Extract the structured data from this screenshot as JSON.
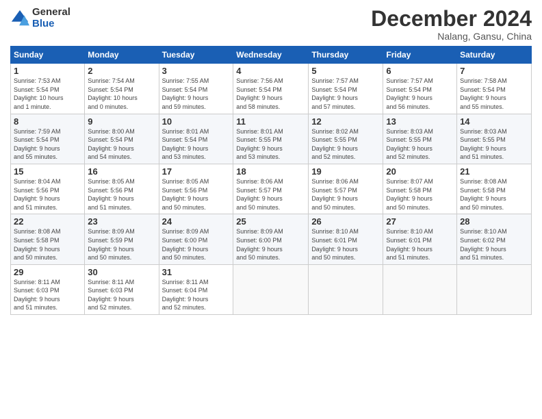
{
  "logo": {
    "general": "General",
    "blue": "Blue"
  },
  "header": {
    "month": "December 2024",
    "location": "Nalang, Gansu, China"
  },
  "days_of_week": [
    "Sunday",
    "Monday",
    "Tuesday",
    "Wednesday",
    "Thursday",
    "Friday",
    "Saturday"
  ],
  "weeks": [
    [
      {
        "day": "1",
        "info": "Sunrise: 7:53 AM\nSunset: 5:54 PM\nDaylight: 10 hours\nand 1 minute."
      },
      {
        "day": "2",
        "info": "Sunrise: 7:54 AM\nSunset: 5:54 PM\nDaylight: 10 hours\nand 0 minutes."
      },
      {
        "day": "3",
        "info": "Sunrise: 7:55 AM\nSunset: 5:54 PM\nDaylight: 9 hours\nand 59 minutes."
      },
      {
        "day": "4",
        "info": "Sunrise: 7:56 AM\nSunset: 5:54 PM\nDaylight: 9 hours\nand 58 minutes."
      },
      {
        "day": "5",
        "info": "Sunrise: 7:57 AM\nSunset: 5:54 PM\nDaylight: 9 hours\nand 57 minutes."
      },
      {
        "day": "6",
        "info": "Sunrise: 7:57 AM\nSunset: 5:54 PM\nDaylight: 9 hours\nand 56 minutes."
      },
      {
        "day": "7",
        "info": "Sunrise: 7:58 AM\nSunset: 5:54 PM\nDaylight: 9 hours\nand 55 minutes."
      }
    ],
    [
      {
        "day": "8",
        "info": "Sunrise: 7:59 AM\nSunset: 5:54 PM\nDaylight: 9 hours\nand 55 minutes."
      },
      {
        "day": "9",
        "info": "Sunrise: 8:00 AM\nSunset: 5:54 PM\nDaylight: 9 hours\nand 54 minutes."
      },
      {
        "day": "10",
        "info": "Sunrise: 8:01 AM\nSunset: 5:54 PM\nDaylight: 9 hours\nand 53 minutes."
      },
      {
        "day": "11",
        "info": "Sunrise: 8:01 AM\nSunset: 5:55 PM\nDaylight: 9 hours\nand 53 minutes."
      },
      {
        "day": "12",
        "info": "Sunrise: 8:02 AM\nSunset: 5:55 PM\nDaylight: 9 hours\nand 52 minutes."
      },
      {
        "day": "13",
        "info": "Sunrise: 8:03 AM\nSunset: 5:55 PM\nDaylight: 9 hours\nand 52 minutes."
      },
      {
        "day": "14",
        "info": "Sunrise: 8:03 AM\nSunset: 5:55 PM\nDaylight: 9 hours\nand 51 minutes."
      }
    ],
    [
      {
        "day": "15",
        "info": "Sunrise: 8:04 AM\nSunset: 5:56 PM\nDaylight: 9 hours\nand 51 minutes."
      },
      {
        "day": "16",
        "info": "Sunrise: 8:05 AM\nSunset: 5:56 PM\nDaylight: 9 hours\nand 51 minutes."
      },
      {
        "day": "17",
        "info": "Sunrise: 8:05 AM\nSunset: 5:56 PM\nDaylight: 9 hours\nand 50 minutes."
      },
      {
        "day": "18",
        "info": "Sunrise: 8:06 AM\nSunset: 5:57 PM\nDaylight: 9 hours\nand 50 minutes."
      },
      {
        "day": "19",
        "info": "Sunrise: 8:06 AM\nSunset: 5:57 PM\nDaylight: 9 hours\nand 50 minutes."
      },
      {
        "day": "20",
        "info": "Sunrise: 8:07 AM\nSunset: 5:58 PM\nDaylight: 9 hours\nand 50 minutes."
      },
      {
        "day": "21",
        "info": "Sunrise: 8:08 AM\nSunset: 5:58 PM\nDaylight: 9 hours\nand 50 minutes."
      }
    ],
    [
      {
        "day": "22",
        "info": "Sunrise: 8:08 AM\nSunset: 5:58 PM\nDaylight: 9 hours\nand 50 minutes."
      },
      {
        "day": "23",
        "info": "Sunrise: 8:09 AM\nSunset: 5:59 PM\nDaylight: 9 hours\nand 50 minutes."
      },
      {
        "day": "24",
        "info": "Sunrise: 8:09 AM\nSunset: 6:00 PM\nDaylight: 9 hours\nand 50 minutes."
      },
      {
        "day": "25",
        "info": "Sunrise: 8:09 AM\nSunset: 6:00 PM\nDaylight: 9 hours\nand 50 minutes."
      },
      {
        "day": "26",
        "info": "Sunrise: 8:10 AM\nSunset: 6:01 PM\nDaylight: 9 hours\nand 50 minutes."
      },
      {
        "day": "27",
        "info": "Sunrise: 8:10 AM\nSunset: 6:01 PM\nDaylight: 9 hours\nand 51 minutes."
      },
      {
        "day": "28",
        "info": "Sunrise: 8:10 AM\nSunset: 6:02 PM\nDaylight: 9 hours\nand 51 minutes."
      }
    ],
    [
      {
        "day": "29",
        "info": "Sunrise: 8:11 AM\nSunset: 6:03 PM\nDaylight: 9 hours\nand 51 minutes."
      },
      {
        "day": "30",
        "info": "Sunrise: 8:11 AM\nSunset: 6:03 PM\nDaylight: 9 hours\nand 52 minutes."
      },
      {
        "day": "31",
        "info": "Sunrise: 8:11 AM\nSunset: 6:04 PM\nDaylight: 9 hours\nand 52 minutes."
      },
      null,
      null,
      null,
      null
    ]
  ]
}
